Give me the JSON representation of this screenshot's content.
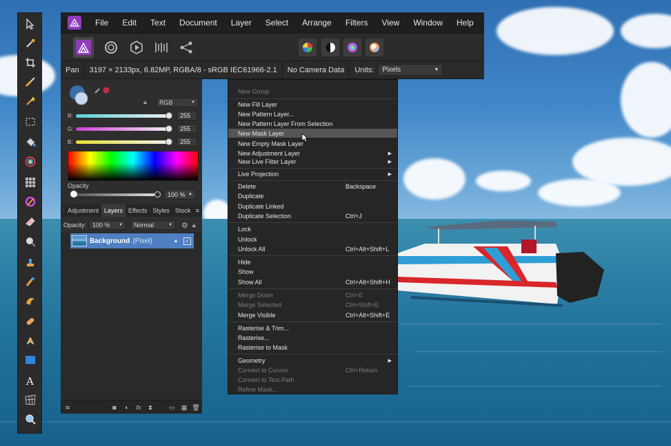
{
  "menubar": {
    "items": [
      "File",
      "Edit",
      "Text",
      "Document",
      "Layer",
      "Select",
      "Arrange",
      "Filters",
      "View",
      "Window",
      "Help"
    ]
  },
  "toolbar": {
    "personas": [
      "photo-persona-icon",
      "liquify-persona-icon",
      "develop-persona-icon",
      "tone-mapping-persona-icon",
      "export-persona-icon"
    ],
    "right_buttons": [
      "color-wheel-icon",
      "contrast-icon",
      "saturation-icon",
      "white-balance-icon"
    ]
  },
  "context_bar": {
    "tool": "Pan",
    "doc_info": "3197 × 2133px, 6.82MP, RGBA/8 - sRGB IEC61966-2.1",
    "camera": "No Camera Data",
    "units_label": "Units:",
    "units_value": "Pixels"
  },
  "color_panel": {
    "mode": "RGB",
    "r_label": "R:",
    "r_value": "255",
    "g_label": "G:",
    "g_value": "255",
    "b_label": "B:",
    "b_value": "255",
    "opacity_label": "Opacity",
    "opacity_value": "100 %"
  },
  "panel_tabs": [
    "Adjustment",
    "Layers",
    "Effects",
    "Styles",
    "Stock"
  ],
  "layers_panel": {
    "opacity_label": "Opacity:",
    "opacity_value": "100 %",
    "blend_mode": "Normal",
    "layer_name": "Background",
    "layer_type": "(Pixel)"
  },
  "context_menu": {
    "items": [
      {
        "label": "New Group",
        "shortcut": "",
        "disabled": true
      },
      {
        "label": "New Fill Layer",
        "shortcut": ""
      },
      {
        "label": "New Pattern Layer...",
        "shortcut": ""
      },
      {
        "label": "New Pattern Layer From Selection",
        "shortcut": ""
      },
      {
        "label": "New Mask Layer",
        "shortcut": "",
        "highlighted": true
      },
      {
        "label": "New Empty Mask Layer",
        "shortcut": ""
      },
      {
        "label": "New Adjustment Layer",
        "shortcut": "",
        "submenu": true
      },
      {
        "label": "New Live Filter Layer",
        "shortcut": "",
        "submenu": true
      },
      {
        "label": "Live Projection",
        "shortcut": "",
        "submenu": true
      },
      {
        "label": "Delete",
        "shortcut": "Backspace"
      },
      {
        "label": "Duplicate",
        "shortcut": ""
      },
      {
        "label": "Duplicate Linked",
        "shortcut": ""
      },
      {
        "label": "Duplicate Selection",
        "shortcut": "Ctrl+J"
      },
      {
        "label": "Lock",
        "shortcut": ""
      },
      {
        "label": "Unlock",
        "shortcut": ""
      },
      {
        "label": "Unlock All",
        "shortcut": "Ctrl+Alt+Shift+L"
      },
      {
        "label": "Hide",
        "shortcut": ""
      },
      {
        "label": "Show",
        "shortcut": ""
      },
      {
        "label": "Show All",
        "shortcut": "Ctrl+Alt+Shift+H"
      },
      {
        "label": "Merge Down",
        "shortcut": "Ctrl+E",
        "disabled": true
      },
      {
        "label": "Merge Selected",
        "shortcut": "Ctrl+Shift+E",
        "disabled": true
      },
      {
        "label": "Merge Visible",
        "shortcut": "Ctrl+Alt+Shift+E"
      },
      {
        "label": "Rasterise & Trim...",
        "shortcut": ""
      },
      {
        "label": "Rasterise...",
        "shortcut": ""
      },
      {
        "label": "Rasterise to Mask",
        "shortcut": ""
      },
      {
        "label": "Geometry",
        "shortcut": "",
        "submenu": true
      },
      {
        "label": "Convert to Curves",
        "shortcut": "Ctrl+Return",
        "disabled": true
      },
      {
        "label": "Convert to Text Path",
        "shortcut": "",
        "disabled": true
      },
      {
        "label": "Refine Mask...",
        "shortcut": "",
        "disabled": true
      }
    ]
  },
  "tools_panel": {
    "tools": [
      "move-icon",
      "color-picker-icon",
      "crop-icon",
      "selection-brush-icon",
      "flood-select-icon",
      "marquee-icon",
      "fill-icon",
      "gradient-icon",
      "grid-icon",
      "color-brush-icon",
      "erase-brush-icon",
      "dodge-icon",
      "clone-icon",
      "healing-icon",
      "smudge-icon",
      "red-eye-icon",
      "pen-icon",
      "rectangle-icon",
      "text-icon",
      "mesh-warp-icon",
      "zoom-icon"
    ]
  },
  "colors": {
    "accent": "#4f7fc1",
    "menu_bg": "#262626",
    "panel_bg": "#2f2f2f",
    "brand": "#8e3dbd"
  }
}
